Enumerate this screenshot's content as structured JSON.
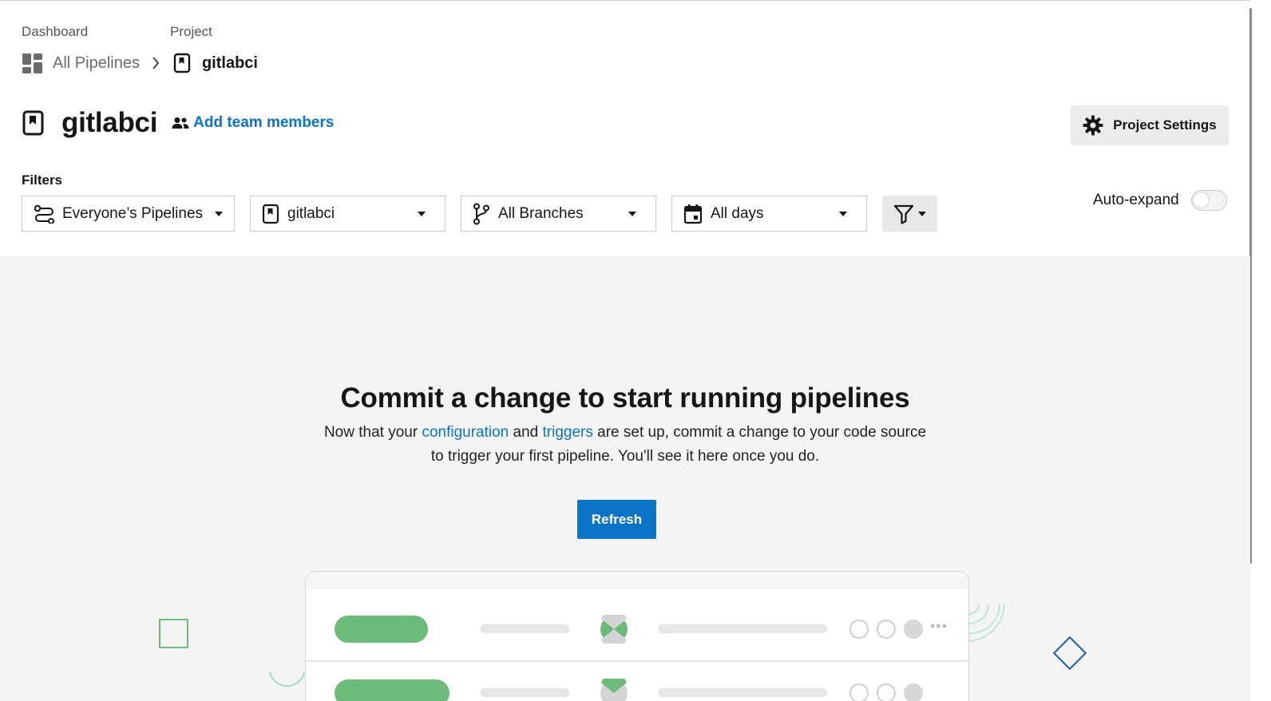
{
  "breadcrumb": {
    "dashboard_label": "Dashboard",
    "project_label": "Project",
    "all_pipelines": "All Pipelines",
    "project_name": "gitlabci"
  },
  "header": {
    "title": "gitlabci",
    "add_team_members": "Add team members",
    "project_settings": "Project Settings"
  },
  "filters": {
    "label": "Filters",
    "owner": "Everyone’s Pipelines",
    "project": "gitlabci",
    "branch": "All Branches",
    "date": "All days",
    "auto_expand_label": "Auto-expand",
    "auto_expand_on": false
  },
  "empty_state": {
    "title": "Commit a change to start running pipelines",
    "desc_part1": "Now that your ",
    "link_configuration": "configuration",
    "desc_part2": " and ",
    "link_triggers": "triggers",
    "desc_part3": " are set up, commit a change to your code source to trigger your first pipeline. You'll see it here once you do.",
    "refresh_button": "Refresh"
  },
  "colors": {
    "accent": "#0b74c9",
    "success": "#6dba7b",
    "deco_blue": "#1f5ea8"
  },
  "icons": [
    "dashboard-grid-icon",
    "chevron-right-icon",
    "project-bookmark-icon",
    "people-icon",
    "gear-icon",
    "pipelines-icon",
    "branch-icon",
    "calendar-icon",
    "funnel-icon"
  ]
}
